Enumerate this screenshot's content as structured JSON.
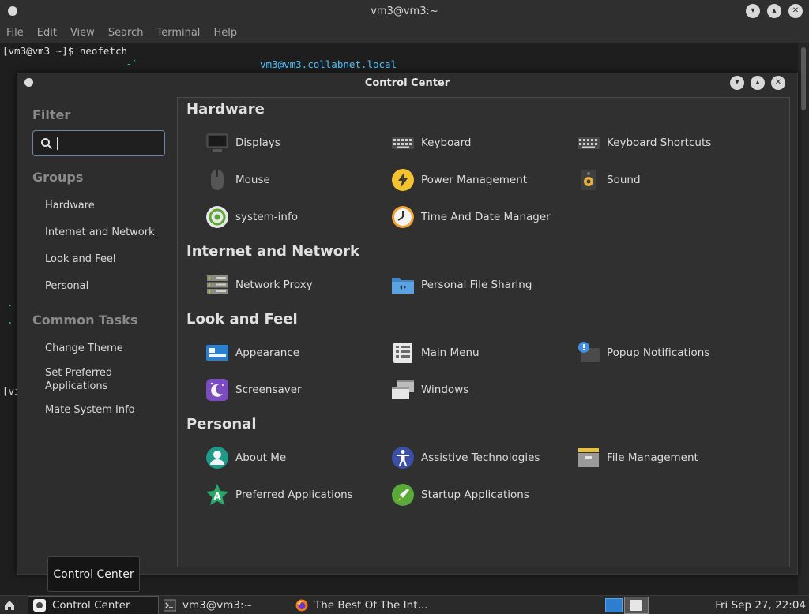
{
  "terminal": {
    "title": "vm3@vm3:~",
    "menu": [
      "File",
      "Edit",
      "View",
      "Search",
      "Terminal",
      "Help"
    ],
    "prompt_line": "[vm3@vm3 ~]$ neofetch",
    "host_line": "vm3@vm3.collabnet.local",
    "art_fragment": "_-`",
    "partial_prompt": "[vi",
    "colors": {
      "host": "#4fc1ff",
      "art": "#24c8a4"
    }
  },
  "control_center": {
    "title": "Control Center",
    "sidebar": {
      "filter_heading": "Filter",
      "search_value": "",
      "groups_heading": "Groups",
      "groups": [
        "Hardware",
        "Internet and Network",
        "Look and Feel",
        "Personal"
      ],
      "tasks_heading": "Common Tasks",
      "tasks": [
        "Change Theme",
        "Set Preferred Applications",
        "Mate System Info"
      ]
    },
    "sections": {
      "hardware": {
        "title": "Hardware",
        "items": [
          {
            "label": "Displays",
            "icon": "display-icon"
          },
          {
            "label": "Keyboard",
            "icon": "keyboard-icon"
          },
          {
            "label": "Keyboard Shortcuts",
            "icon": "keyboard-shortcuts-icon"
          },
          {
            "label": "Mouse",
            "icon": "mouse-icon"
          },
          {
            "label": "Power Management",
            "icon": "power-icon"
          },
          {
            "label": "Sound",
            "icon": "speaker-icon"
          },
          {
            "label": "system-info",
            "icon": "system-info-icon"
          },
          {
            "label": "Time And Date Manager",
            "icon": "clock-icon"
          }
        ]
      },
      "network": {
        "title": "Internet and Network",
        "items": [
          {
            "label": "Network Proxy",
            "icon": "network-proxy-icon"
          },
          {
            "label": "Personal File Sharing",
            "icon": "folder-share-icon"
          }
        ]
      },
      "look": {
        "title": "Look and Feel",
        "items": [
          {
            "label": "Appearance",
            "icon": "appearance-icon"
          },
          {
            "label": "Main Menu",
            "icon": "main-menu-icon"
          },
          {
            "label": "Popup Notifications",
            "icon": "notification-icon"
          },
          {
            "label": "Screensaver",
            "icon": "screensaver-icon"
          },
          {
            "label": "Windows",
            "icon": "windows-icon"
          }
        ]
      },
      "personal": {
        "title": "Personal",
        "items": [
          {
            "label": "About Me",
            "icon": "user-icon"
          },
          {
            "label": "Assistive Technologies",
            "icon": "accessibility-icon"
          },
          {
            "label": "File Management",
            "icon": "file-cabinet-icon"
          },
          {
            "label": "Preferred Applications",
            "icon": "star-app-icon"
          },
          {
            "label": "Startup Applications",
            "icon": "rocket-icon"
          }
        ]
      }
    }
  },
  "tooltip": "Control Center",
  "taskbar": {
    "tasks": [
      {
        "label": "Control Center",
        "icon": "control-center-icon",
        "active": true
      },
      {
        "label": "vm3@vm3:~",
        "icon": "terminal-icon",
        "active": false
      },
      {
        "label": "The Best Of The Int...",
        "icon": "firefox-icon",
        "active": false
      }
    ],
    "clock": "Fri Sep 27, 22:04"
  }
}
